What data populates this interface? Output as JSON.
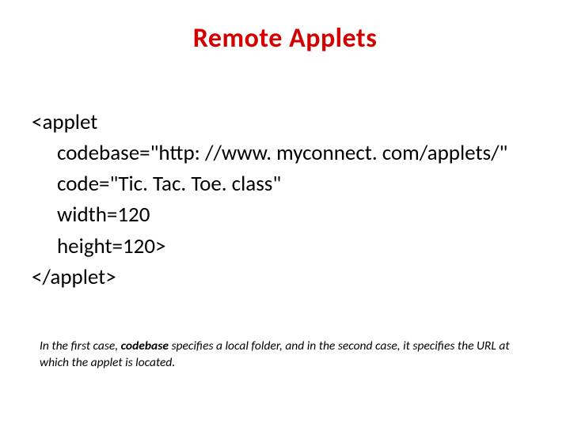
{
  "title": "Remote Applets",
  "code": {
    "open": "<applet",
    "attr_codebase": "codebase=\"http: //www. myconnect. com/applets/\"",
    "attr_code": "code=\"Tic. Tac. Toe. class\"",
    "attr_width": "width=120",
    "attr_height": "height=120>",
    "close": "</applet>"
  },
  "note": {
    "part1": "In the first case, ",
    "bold": "codebase",
    "part2": " specifies a local folder, and in the second case, it specifies the URL at which the applet is located."
  }
}
